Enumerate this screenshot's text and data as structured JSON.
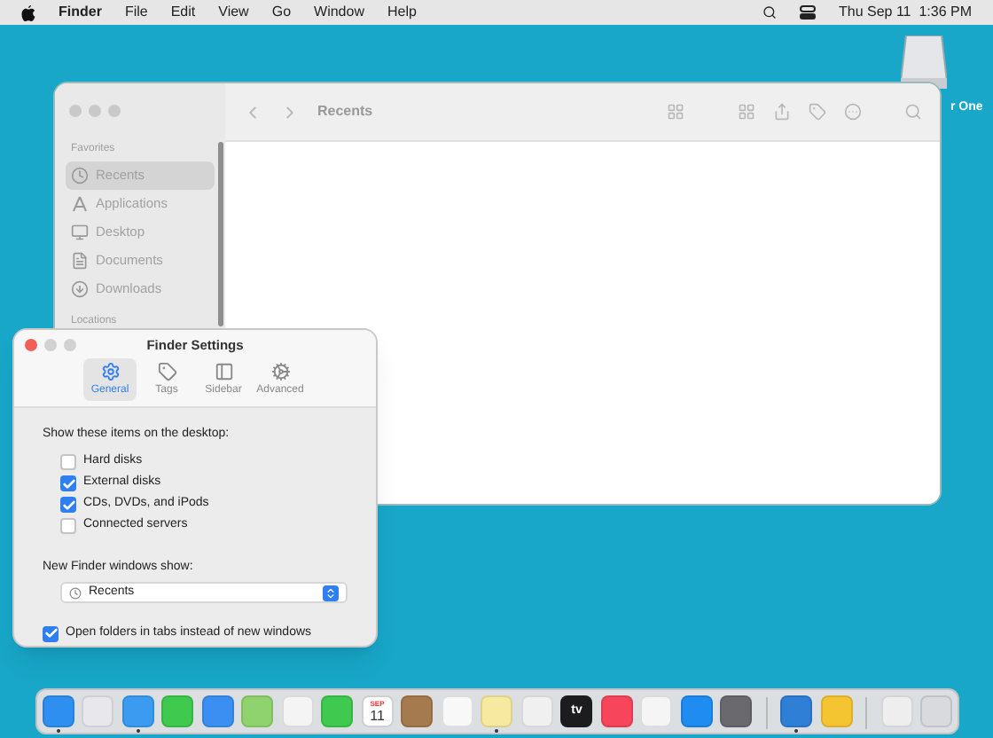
{
  "menu_bar": {
    "app": "Finder",
    "menus": [
      "File",
      "Edit",
      "View",
      "Go",
      "Window",
      "Help"
    ],
    "clock": "Thu Sep 11  1:36 PM"
  },
  "desktop_disk": {
    "label": "r One"
  },
  "finder_window": {
    "title": "Recents",
    "sidebar": {
      "sections": [
        {
          "heading": "Favorites",
          "items": [
            {
              "label": "Recents",
              "kind": "clock",
              "selected": true
            },
            {
              "label": "Applications",
              "kind": "apps",
              "selected": false
            },
            {
              "label": "Desktop",
              "kind": "desktop",
              "selected": false
            },
            {
              "label": "Documents",
              "kind": "doc",
              "selected": false
            },
            {
              "label": "Downloads",
              "kind": "download",
              "selected": false
            }
          ]
        },
        {
          "heading": "Locations"
        }
      ]
    }
  },
  "settings": {
    "title": "Finder Settings",
    "tabs": [
      {
        "label": "General",
        "kind": "gear",
        "selected": true
      },
      {
        "label": "Tags",
        "kind": "tag",
        "selected": false
      },
      {
        "label": "Sidebar",
        "kind": "sidebar",
        "selected": false
      },
      {
        "label": "Advanced",
        "kind": "gears",
        "selected": false
      }
    ],
    "desktop_heading": "Show these items on the desktop:",
    "desktop_items": [
      {
        "label": "Hard disks",
        "checked": false
      },
      {
        "label": "External disks",
        "checked": true
      },
      {
        "label": "CDs, DVDs, and iPods",
        "checked": true
      },
      {
        "label": "Connected servers",
        "checked": false
      }
    ],
    "new_window_label": "New Finder windows show:",
    "new_window_value": "Recents",
    "open_in_tabs": {
      "label": "Open folders in tabs instead of new windows",
      "checked": true
    }
  },
  "dock": [
    {
      "kind": "app",
      "color": "#2f8ff0",
      "running": true
    },
    {
      "kind": "app",
      "color": "#e8e8ec",
      "running": false
    },
    {
      "kind": "app",
      "color": "#3a9bf0",
      "running": true
    },
    {
      "kind": "app",
      "color": "#3fc94f",
      "running": false
    },
    {
      "kind": "app",
      "color": "#3b8ff2",
      "running": false
    },
    {
      "kind": "app",
      "color": "#8fd36f",
      "running": false
    },
    {
      "kind": "app",
      "color": "#f4f4f4",
      "running": false
    },
    {
      "kind": "app",
      "color": "#3fc94f",
      "running": false
    },
    {
      "kind": "calendar",
      "color": "#ffffff",
      "month": "SEP",
      "day": "11",
      "running": false
    },
    {
      "kind": "app",
      "color": "#a57a4f",
      "running": false
    },
    {
      "kind": "app",
      "color": "#f8f8f8",
      "running": false
    },
    {
      "kind": "app",
      "color": "#f7e9a0",
      "running": true
    },
    {
      "kind": "app",
      "color": "#f0f0f0",
      "running": false
    },
    {
      "kind": "tv",
      "color": "#1c1c1e",
      "label": "tv",
      "running": false
    },
    {
      "kind": "app",
      "color": "#f7455c",
      "running": false
    },
    {
      "kind": "app",
      "color": "#f5f5f5",
      "running": false
    },
    {
      "kind": "app",
      "color": "#1f8cf2",
      "running": false
    },
    {
      "kind": "app",
      "color": "#6a6a6e",
      "running": false
    },
    {
      "kind": "separator"
    },
    {
      "kind": "app",
      "color": "#2f7fd6",
      "running": true
    },
    {
      "kind": "app",
      "color": "#f5c531",
      "running": false
    },
    {
      "kind": "separator"
    },
    {
      "kind": "app",
      "color": "#eeeeee",
      "running": false
    },
    {
      "kind": "app",
      "color": "#d8dadd",
      "running": false
    }
  ]
}
